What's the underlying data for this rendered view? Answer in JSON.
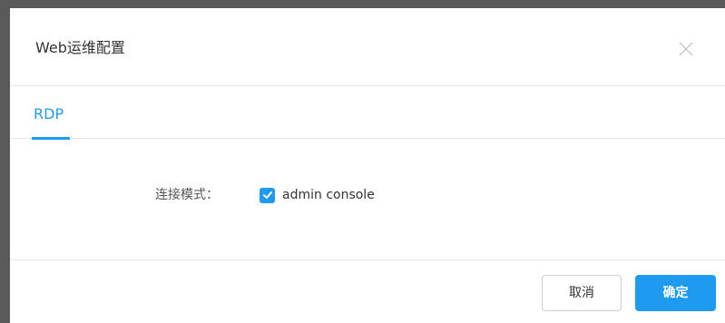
{
  "dialog": {
    "title": "Web运维配置",
    "close_icon": "close-icon"
  },
  "tabs": [
    {
      "label": "RDP",
      "active": true
    }
  ],
  "form": {
    "connection_mode_label": "连接模式：",
    "admin_console": {
      "label": "admin console",
      "checked": true
    }
  },
  "footer": {
    "cancel_label": "取消",
    "confirm_label": "确定"
  },
  "colors": {
    "accent": "#1e9bf0",
    "backdrop": "#5a5a5a",
    "divider": "#e8e8e8"
  }
}
